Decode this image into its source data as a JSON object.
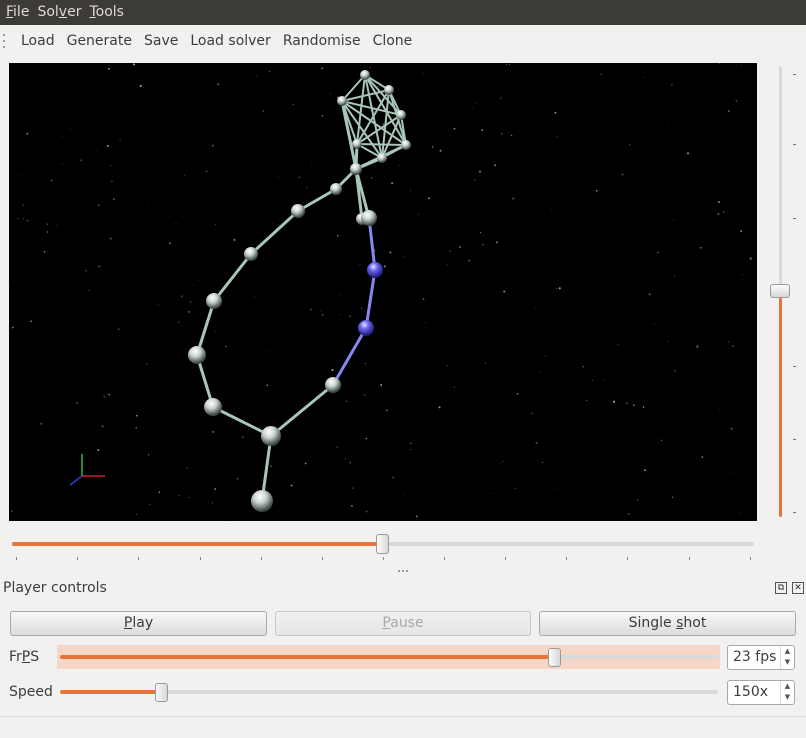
{
  "menubar": {
    "items": [
      {
        "label": "File",
        "mnemonic": "F",
        "rest": "ile"
      },
      {
        "label": "Solver",
        "mnemonic_prefix": "Sol",
        "mnemonic": "v",
        "rest": "er"
      },
      {
        "label": "Tools",
        "mnemonic": "T",
        "rest": "ools"
      }
    ]
  },
  "toolbar": {
    "load": "Load",
    "generate": "Generate",
    "save": "Save",
    "load_solver": "Load solver",
    "randomise": "Randomise",
    "clone": "Clone"
  },
  "viewport": {
    "description_icon": "3d-scene",
    "axis_colors": {
      "x": "#d42020",
      "y": "#2fb24a",
      "z": "#2f3fd4"
    },
    "highlight_node_color": "#5a55e8",
    "node_color": "#c8d2cc",
    "link_color": "#a9c7b9",
    "background": "#000000"
  },
  "timeline": {
    "position_fraction": 0.5
  },
  "zoom_slider": {
    "position_fraction": 0.5
  },
  "dock": {
    "title": "Player controls",
    "float_icon": "float-icon",
    "close_icon": "close-icon"
  },
  "controls": {
    "play_prefix": "",
    "play_mnemonic": "P",
    "play_rest": "lay",
    "pause_mnemonic": "P",
    "pause_rest": "ause",
    "single_prefix": "Single ",
    "single_mnemonic": "s",
    "single_rest": "hot",
    "fps_label_pre": "Fr",
    "fps_label_mnemonic": "P",
    "fps_label_post": "S",
    "fps_value": "23 fps",
    "fps_fraction": 0.75,
    "speed_label": "Speed",
    "speed_value": "150x",
    "speed_fraction": 0.155
  },
  "accent_color": "#e8743b"
}
